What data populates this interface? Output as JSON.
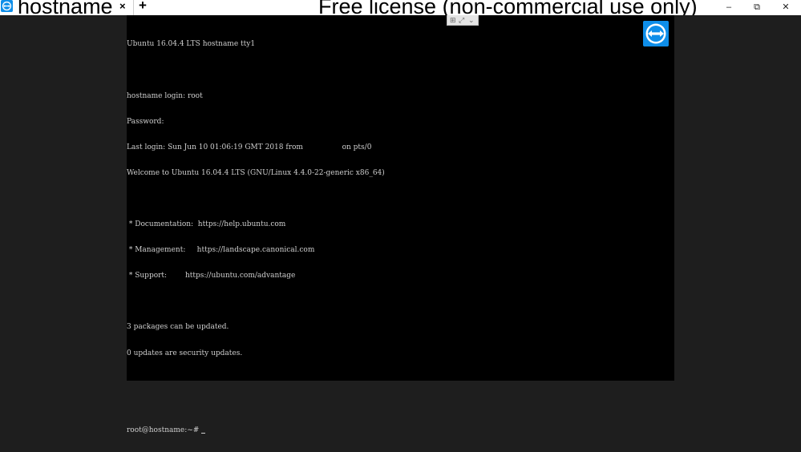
{
  "titlebar": {
    "tab_title": "hostname",
    "tab_close": "×",
    "new_tab": "+",
    "window_title": "Free license (non-commercial use only)",
    "minimize": "–",
    "maximize": "⧉",
    "close": "✕"
  },
  "colors": {
    "brand_blue": "#0e8ee9",
    "terminal_bg": "#000000",
    "terminal_fg": "#cfcfcf",
    "side_bg": "#1e1e1e"
  },
  "icons": {
    "app": "teamviewer-icon",
    "remote_logo": "teamviewer-icon"
  },
  "terminal": {
    "lines": [
      "Ubuntu 16.04.4 LTS hostname tty1",
      "",
      "hostname login: root",
      "Password:",
      "Last login: Sun Jun 10 01:06:19 GMT 2018 from                 on pts/0",
      "Welcome to Ubuntu 16.04.4 LTS (GNU/Linux 4.4.0-22-generic x86_64)",
      "",
      " * Documentation:  https://help.ubuntu.com",
      " * Management:     https://landscape.canonical.com",
      " * Support:        https://ubuntu.com/advantage",
      "",
      "3 packages can be updated.",
      "0 updates are security updates.",
      "",
      "",
      "root@hostname:~#"
    ]
  }
}
